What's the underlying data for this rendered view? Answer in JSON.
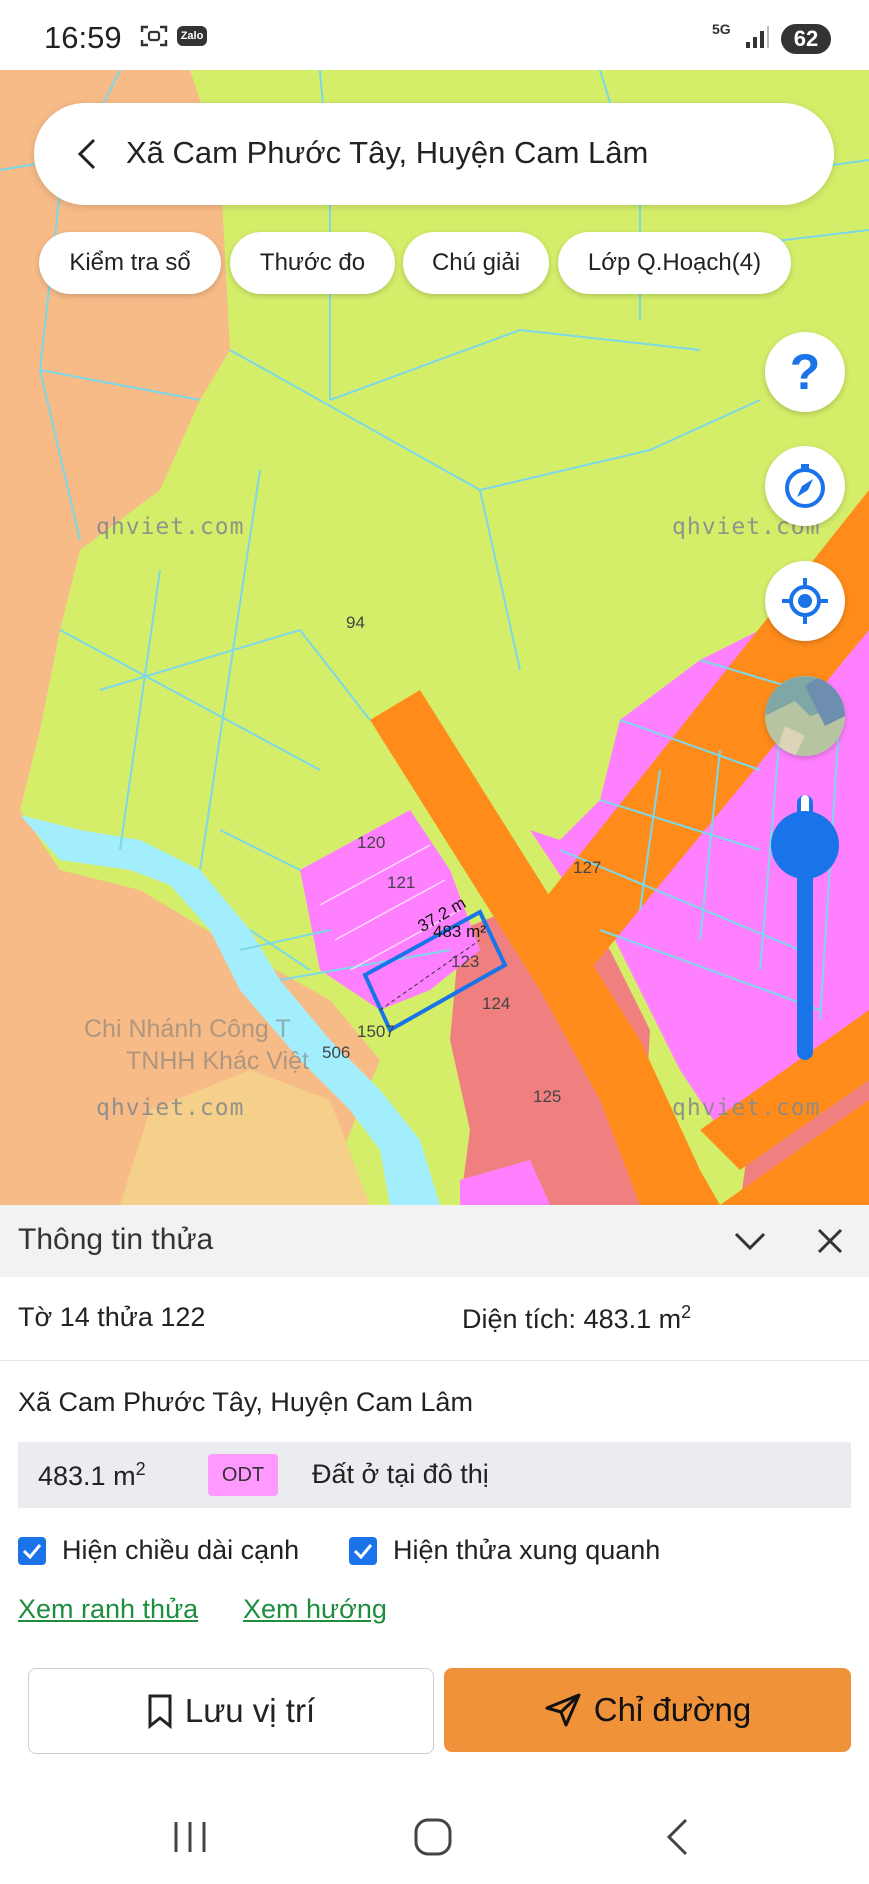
{
  "status_bar": {
    "time": "16:59",
    "zalo_label": "Zalo",
    "network": "5G",
    "battery": "62",
    "icons": [
      "scan-icon",
      "zalo-icon",
      "signal-icon",
      "battery-icon"
    ]
  },
  "search": {
    "title": "Xã Cam Phước Tây, Huyện Cam Lâm",
    "back_icon": "chevron-left-icon"
  },
  "chips": [
    {
      "label": "Kiểm tra sổ"
    },
    {
      "label": "Thước đo"
    },
    {
      "label": "Chú giải"
    },
    {
      "label": "Lớp Q.Hoạch(4)"
    }
  ],
  "map": {
    "parcel_labels": [
      "94",
      "120",
      "121",
      "127",
      "123",
      "124",
      "1507",
      "506",
      "125"
    ],
    "edge_length": "37.2 m",
    "parcel_area": "483 m²",
    "watermarks": [
      "qhviet.com",
      "qhviet.com",
      "qhviet.com",
      "qhviet.com"
    ],
    "faded_lines": [
      "Chi Nhánh Công T",
      "TNHH Khác Việt"
    ],
    "zoom_level": 0.92,
    "colors": {
      "agricultural": "#d4ee6a",
      "forest": "#f7bb88",
      "road": "#ff8c1a",
      "residential_odt": "#ff80ff",
      "residential_rural": "#f08080",
      "water": "#a3eefc",
      "parcel_lines": "#7cd8e8",
      "selection": "#1874e8"
    },
    "fab_icons": [
      "help-icon",
      "compass-icon",
      "my-location-icon",
      "satellite-layer-icon"
    ],
    "help_glyph": "?"
  },
  "panel": {
    "title": "Thông tin thửa",
    "sheet_parcel": "Tờ 14 thửa 122",
    "area_label": "Diện tích: 483.1 m",
    "area_sup": "2",
    "address": "Xã Cam Phước Tây, Huyện Cam Lâm",
    "land_area": "483.1 m",
    "land_area_sup": "2",
    "land_code": "ODT",
    "land_type": "Đất ở tại đô thị",
    "checkbox_edge": "Hiện chiều dài cạnh",
    "checkbox_neighbors": "Hiện thửa xung quanh",
    "link_boundary": "Xem ranh thửa",
    "link_direction": "Xem hướng",
    "save_label": "Lưu vị trí",
    "direction_label": "Chỉ đường"
  },
  "nav": {
    "icons": [
      "recent-apps-icon",
      "home-icon",
      "back-icon"
    ]
  }
}
